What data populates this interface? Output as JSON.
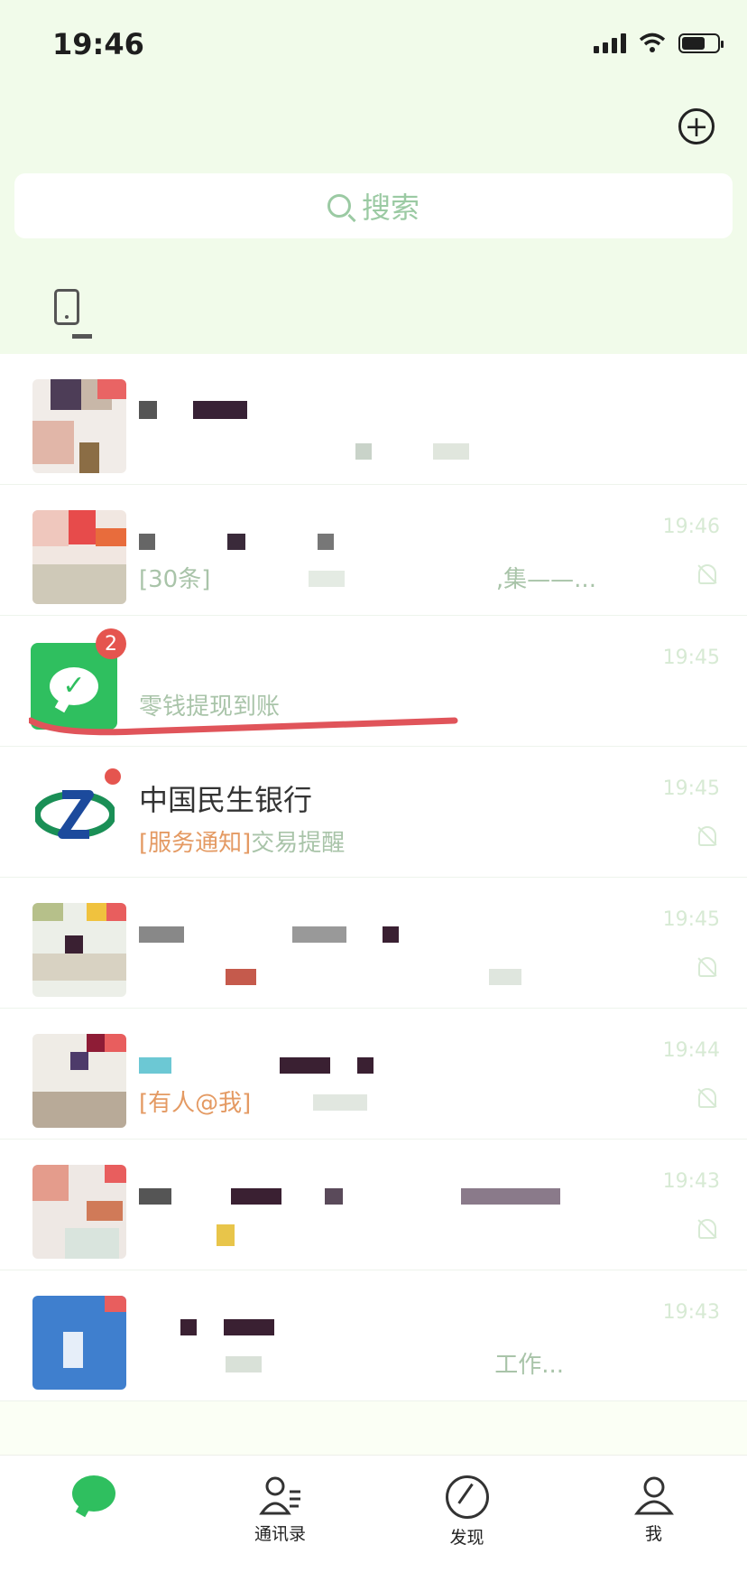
{
  "statusbar": {
    "time": "19:46"
  },
  "header": {
    "add_icon": "plus-circle-icon",
    "search_placeholder": "搜索",
    "device_icon": "tablet-icon"
  },
  "chats": [
    {
      "time": "",
      "muted": false
    },
    {
      "time": "19:46",
      "snippet": "[30条]",
      "snippet_tail": ",集——...",
      "muted": true
    },
    {
      "name": "",
      "time": "19:45",
      "snippet": "零钱提现到账",
      "badge": "2",
      "muted": false
    },
    {
      "name": "中国民生银行",
      "time": "19:45",
      "snippet_tag": "[服务通知]",
      "snippet": "交易提醒",
      "dot": true,
      "muted": true
    },
    {
      "time": "19:45",
      "muted": true
    },
    {
      "time": "19:44",
      "snippet": "[有人@我]",
      "muted": true
    },
    {
      "time": "19:43",
      "muted": true
    },
    {
      "time": "19:43",
      "snippet_tail": "工作...",
      "muted": false
    }
  ],
  "tabbar": {
    "chats_label": "",
    "contacts_label": "通讯录",
    "discover_label": "发现",
    "me_label": "我"
  }
}
